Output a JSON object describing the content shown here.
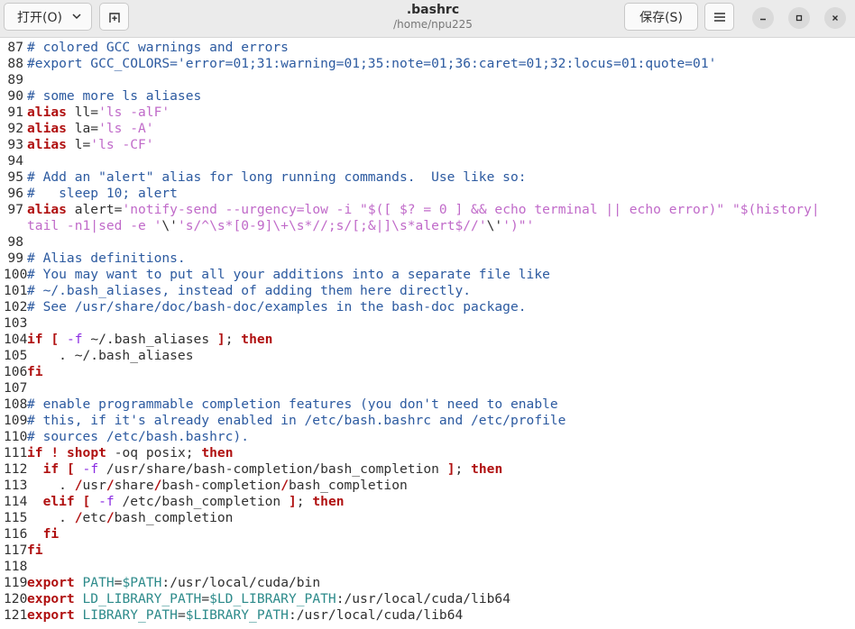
{
  "header": {
    "open_label": "打开(O)",
    "save_label": "保存(S)",
    "title": ".bashrc",
    "subtitle": "/home/npu225"
  },
  "editor": {
    "lines": [
      {
        "n": "87",
        "segs": [
          {
            "t": "# colored GCC warnings and errors",
            "c": "comment"
          }
        ]
      },
      {
        "n": "88",
        "segs": [
          {
            "t": "#export GCC_COLORS='error=01;31:warning=01;35:note=01;36:caret=01;32:locus=01:quote=01'",
            "c": "comment"
          }
        ]
      },
      {
        "n": "89",
        "segs": []
      },
      {
        "n": "90",
        "segs": [
          {
            "t": "# some more ls aliases",
            "c": "comment"
          }
        ]
      },
      {
        "n": "91",
        "segs": [
          {
            "t": "alias",
            "c": "kw"
          },
          {
            "t": " ll=",
            "c": "plain"
          },
          {
            "t": "'ls -alF'",
            "c": "str"
          }
        ]
      },
      {
        "n": "92",
        "segs": [
          {
            "t": "alias",
            "c": "kw"
          },
          {
            "t": " la=",
            "c": "plain"
          },
          {
            "t": "'ls -A'",
            "c": "str"
          }
        ]
      },
      {
        "n": "93",
        "segs": [
          {
            "t": "alias",
            "c": "kw"
          },
          {
            "t": " l=",
            "c": "plain"
          },
          {
            "t": "'ls -CF'",
            "c": "str"
          }
        ]
      },
      {
        "n": "94",
        "segs": []
      },
      {
        "n": "95",
        "segs": [
          {
            "t": "# Add an \"alert\" alias for long running commands.  Use like so:",
            "c": "comment"
          }
        ]
      },
      {
        "n": "96",
        "segs": [
          {
            "t": "#   sleep 10; alert",
            "c": "comment"
          }
        ]
      },
      {
        "n": "97",
        "segs": [
          {
            "t": "alias",
            "c": "kw"
          },
          {
            "t": " alert=",
            "c": "plain"
          },
          {
            "t": "'notify-send --urgency=low -i \"$([ $? = 0 ] && echo terminal || echo error)\" \"$(history|",
            "c": "str"
          }
        ]
      },
      {
        "n": "",
        "segs": [
          {
            "t": "tail -n1|sed -e '",
            "c": "str"
          },
          {
            "t": "\\'",
            "c": "plain"
          },
          {
            "t": "'s/^\\s*[0-9]\\+\\s*//;s/[;&|]\\s*alert$//'",
            "c": "str"
          },
          {
            "t": "\\'",
            "c": "plain"
          },
          {
            "t": "')\"'",
            "c": "str"
          }
        ]
      },
      {
        "n": "98",
        "segs": []
      },
      {
        "n": "99",
        "segs": [
          {
            "t": "# Alias definitions.",
            "c": "comment"
          }
        ]
      },
      {
        "n": "100",
        "segs": [
          {
            "t": "# You may want to put all your additions into a separate file like",
            "c": "comment"
          }
        ]
      },
      {
        "n": "101",
        "segs": [
          {
            "t": "# ~/.bash_aliases, instead of adding them here directly.",
            "c": "comment"
          }
        ]
      },
      {
        "n": "102",
        "segs": [
          {
            "t": "# See /usr/share/doc/bash-doc/examples in the bash-doc package.",
            "c": "comment"
          }
        ]
      },
      {
        "n": "103",
        "segs": []
      },
      {
        "n": "104",
        "segs": [
          {
            "t": "if",
            "c": "kw"
          },
          {
            "t": " ",
            "c": "plain"
          },
          {
            "t": "[",
            "c": "kw"
          },
          {
            "t": " ",
            "c": "plain"
          },
          {
            "t": "-f",
            "c": "op"
          },
          {
            "t": " ~/.bash_aliases ",
            "c": "plain"
          },
          {
            "t": "]",
            "c": "kw"
          },
          {
            "t": "; ",
            "c": "plain"
          },
          {
            "t": "then",
            "c": "kw"
          }
        ]
      },
      {
        "n": "105",
        "segs": [
          {
            "t": "    . ~/.bash_aliases",
            "c": "plain"
          }
        ]
      },
      {
        "n": "106",
        "segs": [
          {
            "t": "fi",
            "c": "kw"
          }
        ]
      },
      {
        "n": "107",
        "segs": []
      },
      {
        "n": "108",
        "segs": [
          {
            "t": "# enable programmable completion features (you don't need to enable",
            "c": "comment"
          }
        ]
      },
      {
        "n": "109",
        "segs": [
          {
            "t": "# this, if it's already enabled in /etc/bash.bashrc and /etc/profile",
            "c": "comment"
          }
        ]
      },
      {
        "n": "110",
        "segs": [
          {
            "t": "# sources /etc/bash.bashrc).",
            "c": "comment"
          }
        ]
      },
      {
        "n": "111",
        "segs": [
          {
            "t": "if",
            "c": "kw"
          },
          {
            "t": " ",
            "c": "plain"
          },
          {
            "t": "!",
            "c": "kw"
          },
          {
            "t": " ",
            "c": "plain"
          },
          {
            "t": "shopt",
            "c": "kw"
          },
          {
            "t": " -oq posix",
            "c": "plain"
          },
          {
            "t": "; ",
            "c": "plain"
          },
          {
            "t": "then",
            "c": "kw"
          }
        ]
      },
      {
        "n": "112",
        "segs": [
          {
            "t": "  ",
            "c": "plain"
          },
          {
            "t": "if",
            "c": "kw"
          },
          {
            "t": " ",
            "c": "plain"
          },
          {
            "t": "[",
            "c": "kw"
          },
          {
            "t": " ",
            "c": "plain"
          },
          {
            "t": "-f",
            "c": "op"
          },
          {
            "t": " /usr/share/bash-completion/bash_completion ",
            "c": "plain"
          },
          {
            "t": "]",
            "c": "kw"
          },
          {
            "t": "; ",
            "c": "plain"
          },
          {
            "t": "then",
            "c": "kw"
          }
        ]
      },
      {
        "n": "113",
        "segs": [
          {
            "t": "    . ",
            "c": "plain"
          },
          {
            "t": "/",
            "c": "kw"
          },
          {
            "t": "usr",
            "c": "plain"
          },
          {
            "t": "/",
            "c": "kw"
          },
          {
            "t": "share",
            "c": "plain"
          },
          {
            "t": "/",
            "c": "kw"
          },
          {
            "t": "bash-completion",
            "c": "plain"
          },
          {
            "t": "/",
            "c": "kw"
          },
          {
            "t": "bash_completion",
            "c": "plain"
          }
        ]
      },
      {
        "n": "114",
        "segs": [
          {
            "t": "  ",
            "c": "plain"
          },
          {
            "t": "elif",
            "c": "kw"
          },
          {
            "t": " ",
            "c": "plain"
          },
          {
            "t": "[",
            "c": "kw"
          },
          {
            "t": " ",
            "c": "plain"
          },
          {
            "t": "-f",
            "c": "op"
          },
          {
            "t": " /etc/bash_completion ",
            "c": "plain"
          },
          {
            "t": "]",
            "c": "kw"
          },
          {
            "t": "; ",
            "c": "plain"
          },
          {
            "t": "then",
            "c": "kw"
          }
        ]
      },
      {
        "n": "115",
        "segs": [
          {
            "t": "    . ",
            "c": "plain"
          },
          {
            "t": "/",
            "c": "kw"
          },
          {
            "t": "etc",
            "c": "plain"
          },
          {
            "t": "/",
            "c": "kw"
          },
          {
            "t": "bash_completion",
            "c": "plain"
          }
        ]
      },
      {
        "n": "116",
        "segs": [
          {
            "t": "  ",
            "c": "plain"
          },
          {
            "t": "fi",
            "c": "kw"
          }
        ]
      },
      {
        "n": "117",
        "segs": [
          {
            "t": "fi",
            "c": "kw"
          }
        ]
      },
      {
        "n": "118",
        "segs": []
      },
      {
        "n": "119",
        "segs": [
          {
            "t": "export",
            "c": "kw"
          },
          {
            "t": " ",
            "c": "plain"
          },
          {
            "t": "PATH",
            "c": "var"
          },
          {
            "t": "=",
            "c": "plain"
          },
          {
            "t": "$PATH",
            "c": "var"
          },
          {
            "t": ":/usr/local/cuda/bin",
            "c": "plain"
          }
        ]
      },
      {
        "n": "120",
        "segs": [
          {
            "t": "export",
            "c": "kw"
          },
          {
            "t": " ",
            "c": "plain"
          },
          {
            "t": "LD_LIBRARY_PATH",
            "c": "var"
          },
          {
            "t": "=",
            "c": "plain"
          },
          {
            "t": "$LD_LIBRARY_PATH",
            "c": "var"
          },
          {
            "t": ":/usr/local/cuda/lib64",
            "c": "plain"
          }
        ]
      },
      {
        "n": "121",
        "segs": [
          {
            "t": "export",
            "c": "kw"
          },
          {
            "t": " ",
            "c": "plain"
          },
          {
            "t": "LIBRARY_PATH",
            "c": "var"
          },
          {
            "t": "=",
            "c": "plain"
          },
          {
            "t": "$LIBRARY_PATH",
            "c": "var"
          },
          {
            "t": ":/usr/local/cuda/lib64",
            "c": "plain"
          }
        ]
      }
    ]
  },
  "colors": {
    "comment": "#2c5aa0",
    "keyword": "#b01010",
    "string": "#c06ac9",
    "variable": "#2c8a8a",
    "headerbar": "#ebebeb"
  },
  "icons": {
    "open_dropdown": "chevron-down-icon",
    "new_tab": "new-tab-icon",
    "menu": "hamburger-menu-icon",
    "minimize": "minimize-icon",
    "maximize": "maximize-icon",
    "close": "close-icon"
  }
}
